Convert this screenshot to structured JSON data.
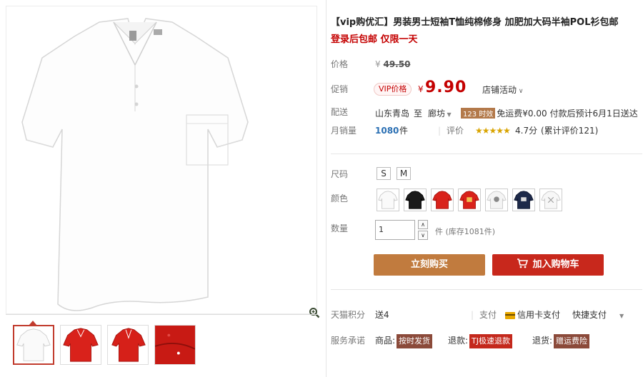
{
  "product": {
    "title": "【vip购优汇】男装男士短袖T恤纯棉修身 加肥加大码半袖POL衫包邮",
    "subtitle": "登录后包邮 仅限一天"
  },
  "price": {
    "label": "价格",
    "currency": "¥",
    "original": "49.50"
  },
  "promo": {
    "label": "促销",
    "vip_badge": "VIP价格",
    "currency": "¥",
    "value": "9.90",
    "shop_activity": "店铺活动"
  },
  "shipping": {
    "label": "配送",
    "from": "山东青岛",
    "to_word": "至",
    "dest": "廊坊",
    "badge": "123 时效",
    "fee_text": "免运费¥0.00",
    "eta": "付款后预计6月1日送达"
  },
  "sales": {
    "label": "月销量",
    "count": "1080",
    "unit": "件",
    "rating_label": "评价",
    "stars": "★★★★★",
    "score": "4.7分",
    "reviews": "(累计评价121)"
  },
  "size": {
    "label": "尺码",
    "options": [
      "S",
      "M"
    ]
  },
  "color": {
    "label": "颜色"
  },
  "quantity": {
    "label": "数量",
    "value": "1",
    "unit": "件",
    "stock": "(库存1081件)"
  },
  "actions": {
    "buy": "立刻购买",
    "cart": "加入购物车"
  },
  "points": {
    "label": "天猫积分",
    "value": "送4",
    "pay_label": "支付",
    "credit": "信用卡支付",
    "quick": "快捷支付"
  },
  "service": {
    "label": "服务承诺",
    "goods_label": "商品:",
    "goods_tag": "按时发货",
    "refund_label": "退款:",
    "refund_tag": "TJ极速退款",
    "return_label": "退货:",
    "return_tag": "赠运费险"
  },
  "colors": {
    "price_red": "#c40000",
    "buy_button": "#c17b3e",
    "cart_button": "#c8281c",
    "shirt_red": "#d9221b"
  }
}
